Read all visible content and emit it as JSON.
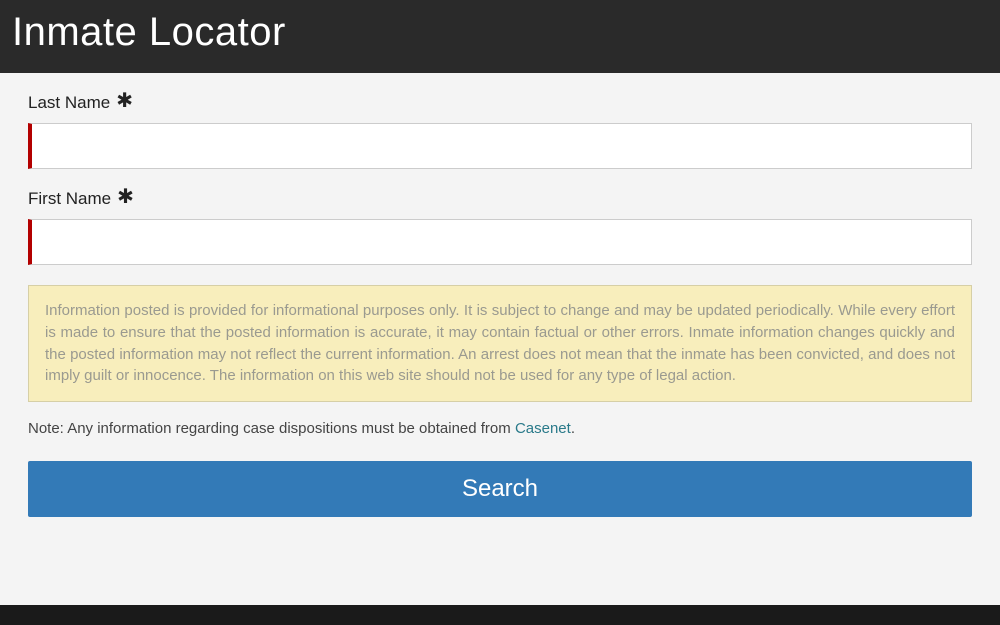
{
  "header": {
    "title": "Inmate Locator"
  },
  "form": {
    "lastName": {
      "label": "Last Name",
      "value": "",
      "required": true
    },
    "firstName": {
      "label": "First Name",
      "value": "",
      "required": true
    },
    "searchButton": "Search"
  },
  "disclaimer": "Information posted is provided for informational purposes only. It is subject to change and may be updated periodically. While every effort is made to ensure that the posted information is accurate, it may contain factual or other errors. Inmate information changes quickly and the posted information may not reflect the current information. An arrest does not mean that the inmate has been convicted, and does not imply guilt or innocence. The information on this web site should not be used for any type of legal action.",
  "note": {
    "prefix": "Note: Any information regarding case dispositions must be obtained from ",
    "linkText": "Casenet",
    "suffix": "."
  },
  "colors": {
    "headerBg": "#2a2a2a",
    "requiredBorder": "#b30000",
    "disclaimerBg": "#f8eebc",
    "primaryButton": "#337ab7",
    "linkColor": "#2a7a8a"
  }
}
